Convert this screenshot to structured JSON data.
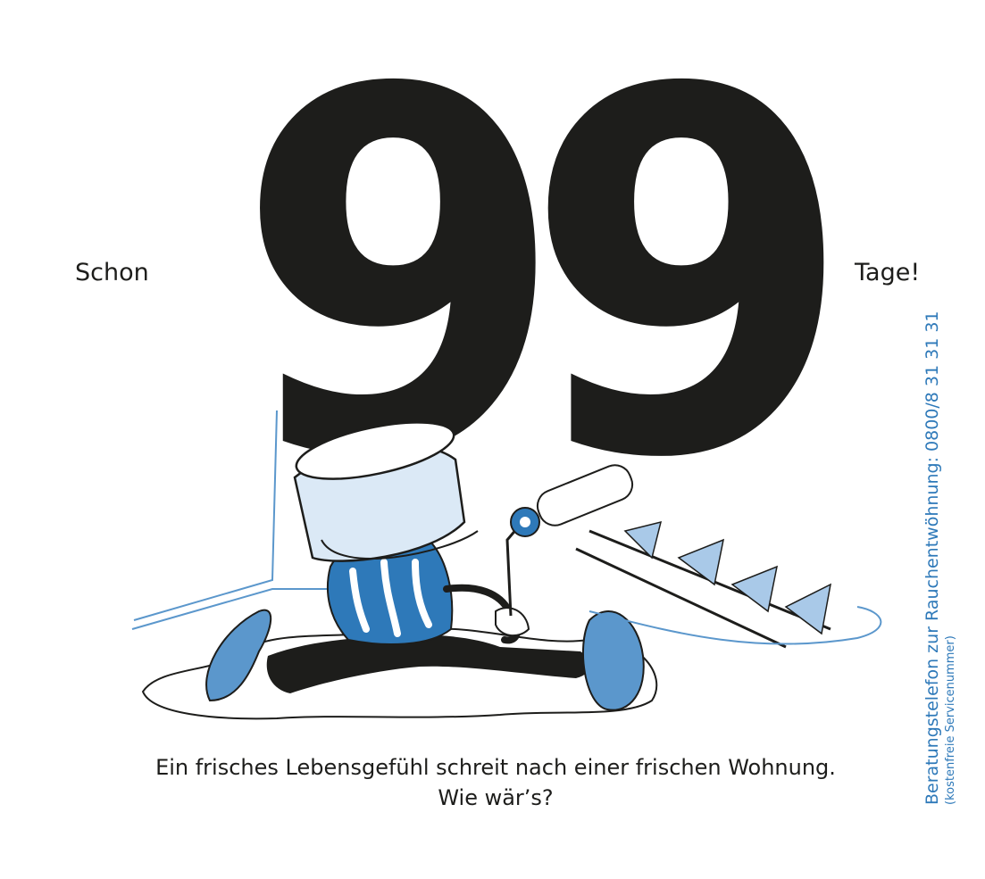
{
  "headline": {
    "prefix": "Schon",
    "number": "99",
    "suffix": "Tage!"
  },
  "caption": {
    "line1": "Ein frisches Lebensgefühl schreit nach einer frischen Wohnung.",
    "line2": "Wie wär’s?"
  },
  "hotline": {
    "line1": "Beratungstelefon zur Rauchentwöhnung: 0800/8 31 31 31",
    "line2": "(kostenfreie Servicenummer)"
  },
  "colors": {
    "text": "#1d1d1b",
    "accent": "#2e79b9",
    "paint_light": "#a9c9e8",
    "paint_mid": "#5b97cc"
  }
}
